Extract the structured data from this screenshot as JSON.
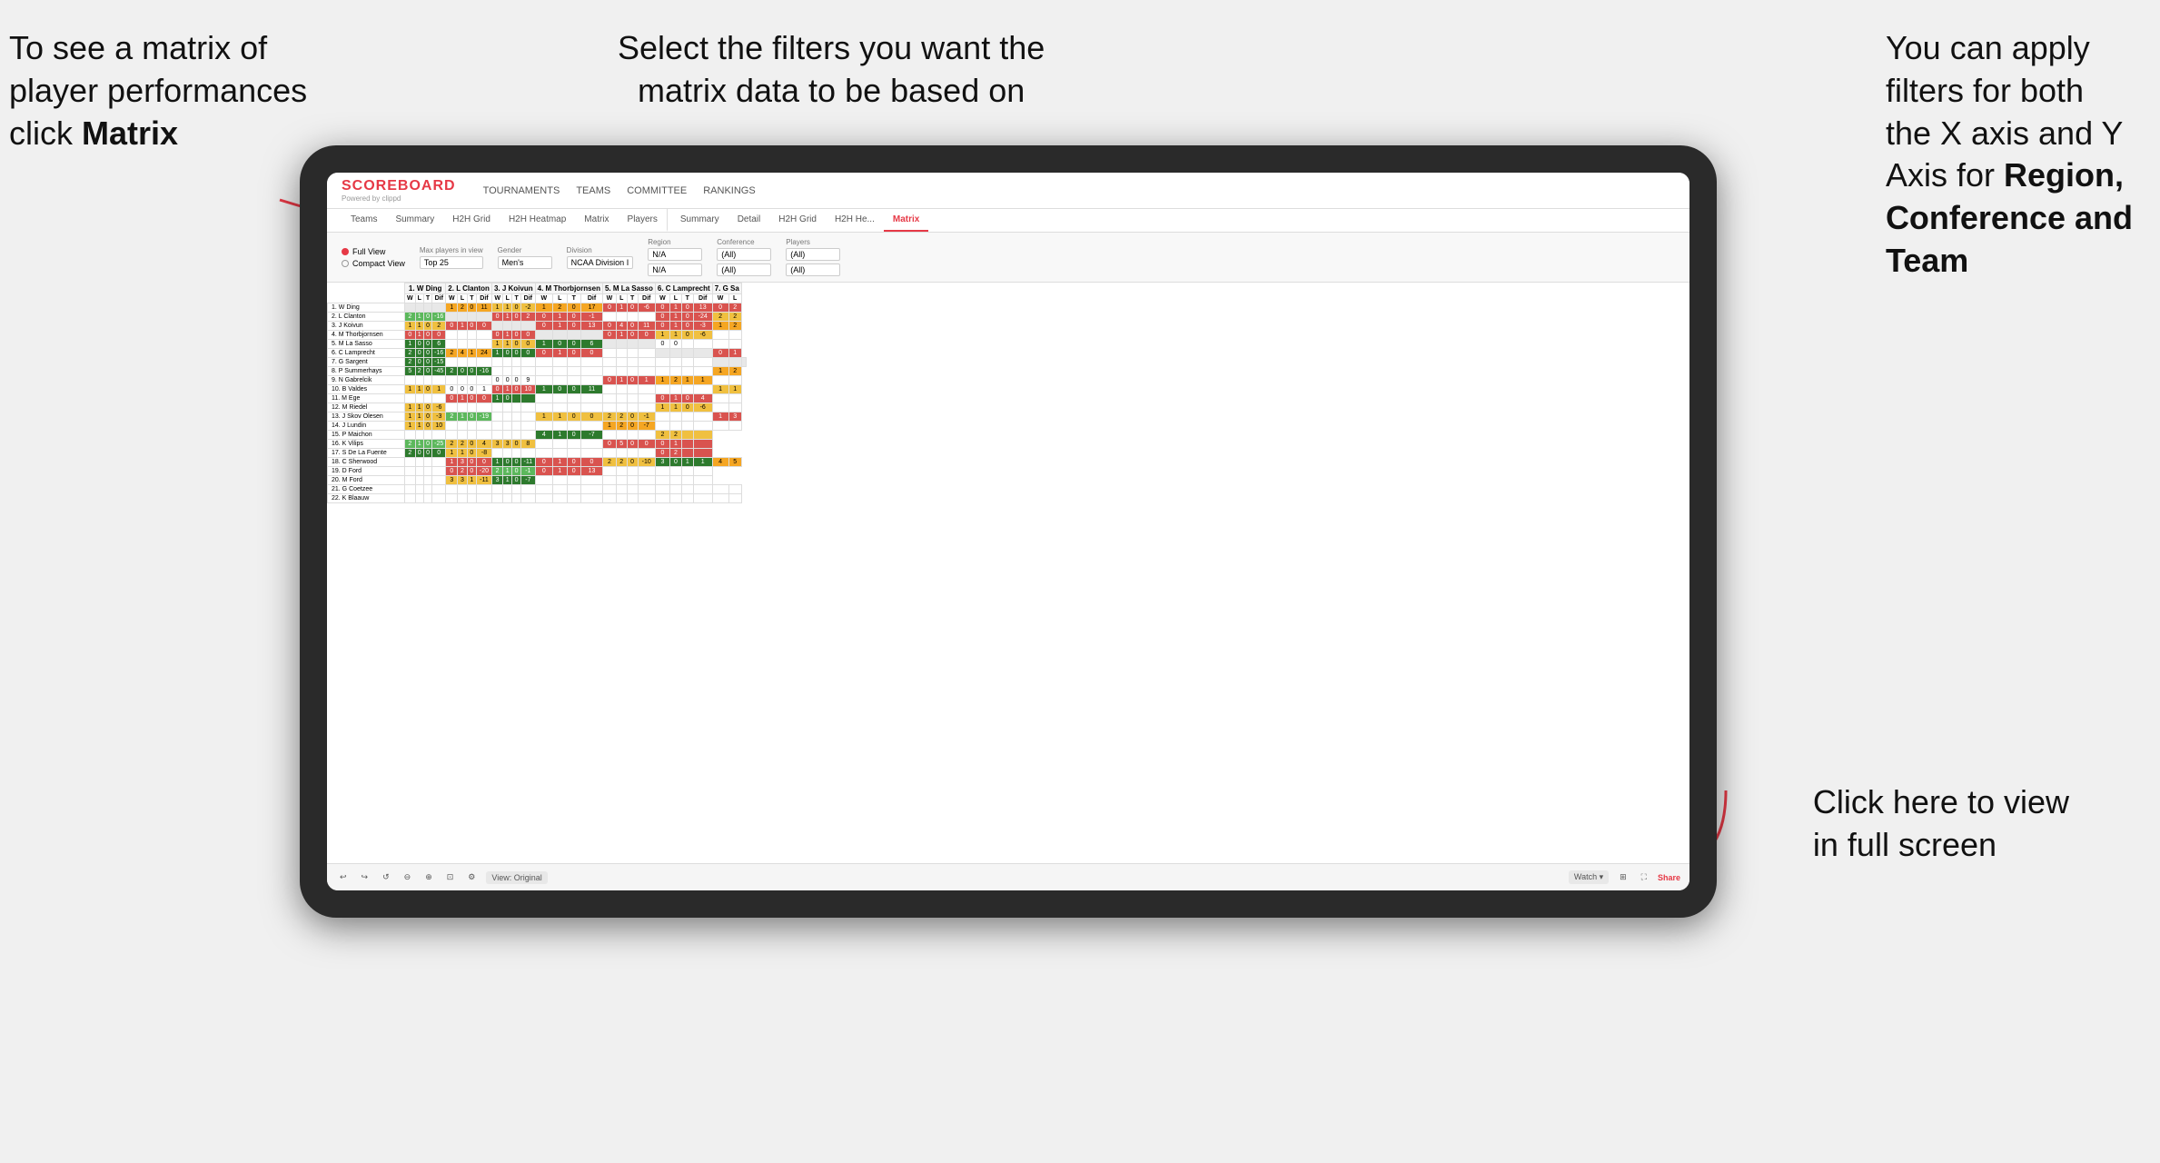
{
  "annotations": {
    "top_left": {
      "line1": "To see a matrix of",
      "line2": "player performances",
      "line3_normal": "click ",
      "line3_bold": "Matrix"
    },
    "top_center": {
      "line1": "Select the filters you want the",
      "line2": "matrix data to be based on"
    },
    "top_right": {
      "line1": "You  can apply",
      "line2": "filters for both",
      "line3": "the X axis and Y",
      "line4_normal": "Axis for ",
      "line4_bold": "Region,",
      "line5_bold": "Conference and",
      "line6_bold": "Team"
    },
    "bottom_right": {
      "line1": "Click here to view",
      "line2": "in full screen"
    }
  },
  "app": {
    "logo": "SCOREBOARD",
    "logo_sub": "Powered by clippd",
    "nav": [
      "TOURNAMENTS",
      "TEAMS",
      "COMMITTEE",
      "RANKINGS"
    ],
    "sub_nav": [
      "Teams",
      "Summary",
      "H2H Grid",
      "H2H Heatmap",
      "Matrix",
      "Players",
      "Summary",
      "Detail",
      "H2H Grid",
      "H2H He...",
      "Matrix"
    ],
    "active_tab": "Matrix"
  },
  "filters": {
    "view_options": [
      "Full View",
      "Compact View"
    ],
    "selected_view": "Full View",
    "max_players_label": "Max players in view",
    "max_players_value": "Top 25",
    "gender_label": "Gender",
    "gender_value": "Men's",
    "division_label": "Division",
    "division_value": "NCAA Division I",
    "region_label": "Region",
    "region_value": "N/A",
    "conference_label": "Conference",
    "conference_value": "(All)",
    "players_label": "Players",
    "players_value": "(All)"
  },
  "matrix": {
    "column_headers": [
      "1. W Ding",
      "2. L Clanton",
      "3. J Koivun",
      "4. M Thorbjornsen",
      "5. M La Sasso",
      "6. C Lamprecht",
      "7. G Sa"
    ],
    "sub_headers": [
      "W",
      "L",
      "T",
      "Dif"
    ],
    "rows": [
      {
        "name": "1. W Ding",
        "data": [
          [],
          [
            1,
            2,
            0,
            11
          ],
          [
            1,
            1,
            0,
            -2
          ],
          [
            1,
            2,
            0,
            17
          ],
          [
            0,
            1,
            0,
            -6
          ],
          [
            0,
            1,
            0,
            13
          ],
          [
            0,
            2
          ]
        ]
      },
      {
        "name": "2. L Clanton",
        "data": [
          [
            2,
            1,
            0,
            -16
          ],
          [],
          [
            0,
            1,
            0,
            2
          ],
          [
            0,
            1,
            0,
            -1
          ],
          [],
          [
            0,
            1,
            0,
            -24
          ],
          [
            2,
            2
          ]
        ]
      },
      {
        "name": "3. J Koivun",
        "data": [
          [
            1,
            1,
            0,
            2
          ],
          [
            0,
            1,
            0,
            0
          ],
          [],
          [
            0,
            1,
            0,
            13
          ],
          [
            0,
            4,
            0,
            11
          ],
          [
            0,
            1,
            0,
            -3
          ],
          [
            1,
            2
          ]
        ]
      },
      {
        "name": "4. M Thorbjornsen",
        "data": [
          [
            0,
            1,
            0,
            0
          ],
          [],
          [
            0,
            1,
            0,
            0
          ],
          [],
          [
            0,
            1,
            0,
            0
          ],
          [
            1,
            1,
            0,
            -6
          ],
          []
        ]
      },
      {
        "name": "5. M La Sasso",
        "data": [
          [
            1,
            0,
            0,
            6
          ],
          [],
          [
            1,
            1,
            0,
            0
          ],
          [
            1,
            0,
            0,
            6
          ],
          [],
          [
            0,
            0
          ],
          []
        ]
      },
      {
        "name": "6. C Lamprecht",
        "data": [
          [
            2,
            0,
            0,
            -16
          ],
          [
            2,
            4,
            1,
            24
          ],
          [
            1,
            0,
            0,
            0
          ],
          [
            0,
            1,
            0,
            0
          ],
          [],
          [],
          [
            0,
            1
          ]
        ]
      },
      {
        "name": "7. G Sargent",
        "data": [
          [
            2,
            0,
            0,
            -15
          ],
          [],
          [],
          [],
          [],
          [],
          []
        ]
      },
      {
        "name": "8. P Summerhays",
        "data": [
          [
            5,
            2,
            0,
            -45
          ],
          [
            2,
            0,
            0,
            -16
          ],
          [],
          [],
          [],
          [],
          [
            1,
            2
          ]
        ]
      },
      {
        "name": "9. N Gabrelcik",
        "data": [
          [],
          [],
          [
            0,
            0,
            0,
            9
          ],
          [],
          [
            0,
            1,
            0,
            1
          ],
          [
            1,
            2,
            1,
            1
          ],
          []
        ]
      },
      {
        "name": "10. B Valdes",
        "data": [
          [
            1,
            1,
            0,
            1
          ],
          [
            0,
            0,
            0,
            1
          ],
          [
            0,
            1,
            0,
            10
          ],
          [
            1,
            0,
            0,
            11
          ],
          [],
          [],
          [
            1,
            1
          ]
        ]
      },
      {
        "name": "11. M Ege",
        "data": [
          [],
          [
            0,
            1,
            0,
            0
          ],
          [
            1,
            0
          ],
          [],
          [],
          [
            0,
            1,
            0,
            4
          ],
          []
        ]
      },
      {
        "name": "12. M Riedel",
        "data": [
          [
            1,
            1,
            0,
            -6
          ],
          [],
          [],
          [],
          [],
          [
            1,
            1,
            0,
            -6
          ],
          []
        ]
      },
      {
        "name": "13. J Skov Olesen",
        "data": [
          [
            1,
            1,
            0,
            -3
          ],
          [
            2,
            1,
            0,
            -19
          ],
          [],
          [
            1,
            1,
            0,
            0
          ],
          [
            2,
            2,
            0,
            -1
          ],
          [],
          [
            1,
            3
          ]
        ]
      },
      {
        "name": "14. J Lundin",
        "data": [
          [
            1,
            1,
            0,
            10
          ],
          [],
          [],
          [],
          [
            1,
            2,
            0,
            -7
          ],
          [],
          []
        ]
      },
      {
        "name": "15. P Maichon",
        "data": [
          [],
          [],
          [],
          [
            4,
            1,
            0,
            -7
          ],
          [],
          [
            2,
            2
          ]
        ]
      },
      {
        "name": "16. K Vilips",
        "data": [
          [
            2,
            1,
            0,
            -25
          ],
          [
            2,
            2,
            0,
            4
          ],
          [
            3,
            3,
            0,
            8
          ],
          [],
          [
            0,
            5,
            0,
            0
          ],
          [
            0,
            1
          ]
        ]
      },
      {
        "name": "17. S De La Fuente",
        "data": [
          [
            2,
            0,
            0,
            0
          ],
          [
            1,
            1,
            0,
            -8
          ],
          [],
          [],
          [],
          [
            0,
            2
          ]
        ]
      },
      {
        "name": "18. C Sherwood",
        "data": [
          [],
          [
            1,
            3,
            0,
            0
          ],
          [
            1,
            0,
            0,
            -11
          ],
          [
            0,
            1,
            0,
            0
          ],
          [
            2,
            2,
            0,
            -10
          ],
          [
            3,
            0,
            1,
            1
          ],
          [
            4,
            5
          ]
        ]
      },
      {
        "name": "19. D Ford",
        "data": [
          [],
          [
            0,
            2,
            0,
            -20
          ],
          [
            2,
            1,
            0,
            -1
          ],
          [
            0,
            1,
            0,
            13
          ],
          [],
          []
        ]
      },
      {
        "name": "20. M Ford",
        "data": [
          [],
          [
            3,
            3,
            1,
            -11
          ],
          [
            3,
            1,
            0,
            -7
          ],
          [],
          [],
          []
        ]
      },
      {
        "name": "21. G Coetzee",
        "data": [
          [],
          [],
          [],
          [],
          [],
          [],
          []
        ]
      },
      {
        "name": "22. K Blaauw",
        "data": [
          [],
          [],
          [],
          [],
          [],
          [],
          []
        ]
      }
    ]
  },
  "toolbar": {
    "view_label": "View: Original",
    "watch_label": "Watch ▾",
    "share_label": "Share"
  }
}
